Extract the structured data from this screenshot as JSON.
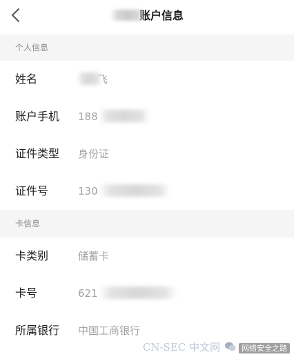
{
  "header": {
    "title_suffix": "账户信息"
  },
  "sections": {
    "personal": {
      "title": "个人信息",
      "rows": {
        "name": {
          "label": "姓名",
          "value": "飞"
        },
        "phone": {
          "label": "账户手机",
          "value": "188"
        },
        "id_type": {
          "label": "证件类型",
          "value": "身份证"
        },
        "id_number": {
          "label": "证件号",
          "value": "130"
        }
      }
    },
    "card": {
      "title": "卡信息",
      "rows": {
        "card_type": {
          "label": "卡类别",
          "value": "储蓄卡"
        },
        "card_number": {
          "label": "卡号",
          "value": "621"
        },
        "bank": {
          "label": "所属银行",
          "value": "中国工商银行"
        }
      }
    }
  },
  "watermark": {
    "text": "CN-SEC 中文网",
    "account": "网络安全之路"
  }
}
